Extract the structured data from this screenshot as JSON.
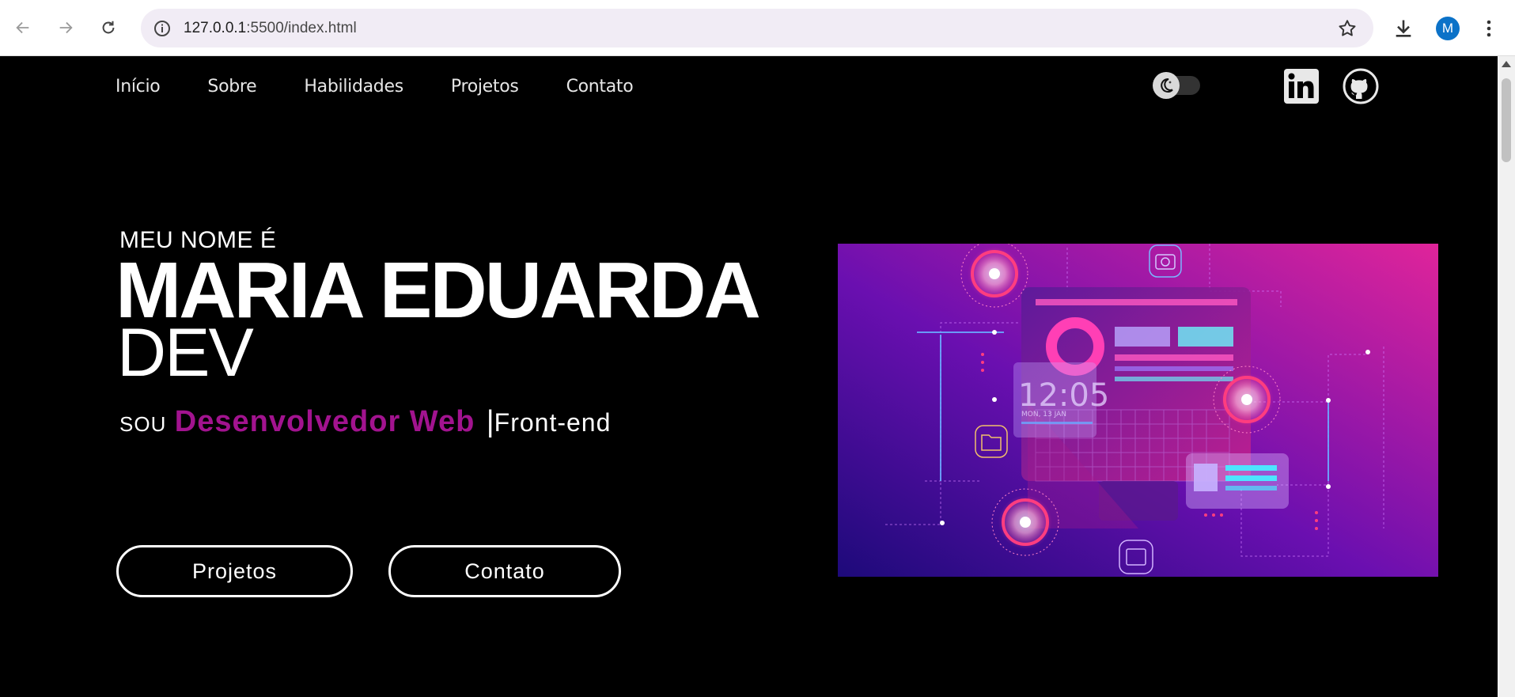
{
  "browser": {
    "url_host": "127.0.0.1",
    "url_path": ":5500/index.html",
    "profile_initial": "M",
    "icons": [
      "back-arrow-icon",
      "forward-arrow-icon",
      "reload-icon",
      "info-icon",
      "star-icon",
      "download-icon",
      "kebab-menu-icon"
    ]
  },
  "nav": {
    "items": [
      {
        "label": "Início"
      },
      {
        "label": "Sobre"
      },
      {
        "label": "Habilidades"
      },
      {
        "label": "Projetos"
      },
      {
        "label": "Contato"
      }
    ]
  },
  "hero": {
    "intro": "MEU NOME É",
    "name": "MARIA EDUARDA",
    "role": "DEV",
    "tagline_prefix": "SOU",
    "tagline_accent": "Desenvolvedor Web",
    "tagline_caret": "|",
    "tagline_typed": "Front-end",
    "buttons": {
      "projetos": "Projetos",
      "contato": "Contato"
    },
    "illustration_clock": "12:05",
    "illustration_date": "MON, 13 JAN"
  },
  "colors": {
    "accent": "#a2138f",
    "background": "#000000"
  }
}
